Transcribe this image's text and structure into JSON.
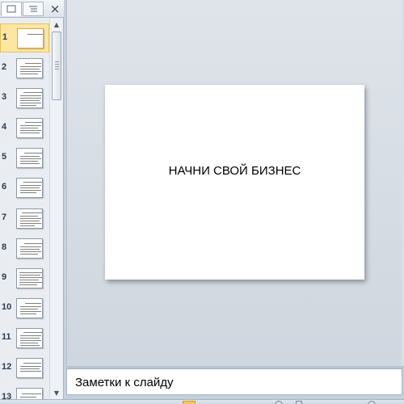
{
  "left_pane": {
    "tabs": [
      {
        "icon": "slides-tab-icon"
      },
      {
        "icon": "outline-tab-icon"
      }
    ],
    "close_label": "×",
    "selected_slide": 1,
    "slides": [
      {
        "number": "1"
      },
      {
        "number": "2"
      },
      {
        "number": "3"
      },
      {
        "number": "4"
      },
      {
        "number": "5"
      },
      {
        "number": "6"
      },
      {
        "number": "7"
      },
      {
        "number": "8"
      },
      {
        "number": "9"
      },
      {
        "number": "10"
      },
      {
        "number": "11"
      },
      {
        "number": "12"
      },
      {
        "number": "13"
      }
    ],
    "scrollbar": {
      "up_arrow": "▲",
      "down_arrow": "▼"
    }
  },
  "slide": {
    "title": "НАЧНИ СВОЙ БИЗНЕС"
  },
  "notes": {
    "placeholder": "Заметки к слайду"
  },
  "colors": {
    "selection": "#fbe6a2",
    "selection_border": "#e8c25e",
    "workspace": "#dfe4ea"
  }
}
